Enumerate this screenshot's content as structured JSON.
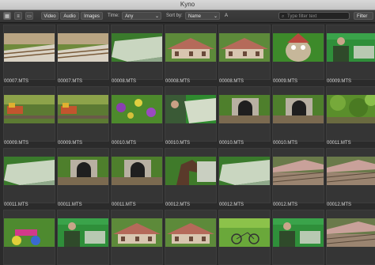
{
  "window": {
    "title": "Kyno"
  },
  "toolbar": {
    "view_icons": [
      "grid-view-icon",
      "list-view-icon",
      "single-view-icon"
    ],
    "filters": [
      "Video",
      "Audio",
      "Images"
    ],
    "time_label": "Time:",
    "time_value": "Any",
    "sort_label": "Sort by:",
    "sort_value": "Name",
    "sort_dir": "A",
    "search_placeholder": "Type filter text",
    "filter_button": "Filter"
  },
  "clips": [
    {
      "name": "00007.MTS",
      "scene": "rail"
    },
    {
      "name": "00007.MTS",
      "scene": "rail"
    },
    {
      "name": "00008.MTS",
      "scene": "board"
    },
    {
      "name": "00008.MTS",
      "scene": "roof"
    },
    {
      "name": "00008.MTS",
      "scene": "roof"
    },
    {
      "name": "00009.MTS",
      "scene": "gnome"
    },
    {
      "name": "00009.MTS",
      "scene": "person"
    },
    {
      "name": "00009.MTS",
      "scene": "train"
    },
    {
      "name": "00009.MTS",
      "scene": "train"
    },
    {
      "name": "00010.MTS",
      "scene": "flowers"
    },
    {
      "name": "00010.MTS",
      "scene": "hand"
    },
    {
      "name": "00010.MTS",
      "scene": "tunnel"
    },
    {
      "name": "00010.MTS",
      "scene": "tunnel"
    },
    {
      "name": "00011.MTS",
      "scene": "foliage"
    },
    {
      "name": "00011.MTS",
      "scene": "board"
    },
    {
      "name": "00011.MTS",
      "scene": "tunnel"
    },
    {
      "name": "00011.MTS",
      "scene": "tunnel"
    },
    {
      "name": "00012.MTS",
      "scene": "horse"
    },
    {
      "name": "00012.MTS",
      "scene": "board"
    },
    {
      "name": "00012.MTS",
      "scene": "station"
    },
    {
      "name": "00012.MTS",
      "scene": "station"
    },
    {
      "name": "",
      "scene": "toy"
    },
    {
      "name": "",
      "scene": "person"
    },
    {
      "name": "",
      "scene": "roof"
    },
    {
      "name": "",
      "scene": "roof"
    },
    {
      "name": "",
      "scene": "bike"
    },
    {
      "name": "",
      "scene": "person"
    },
    {
      "name": "",
      "scene": "station"
    }
  ]
}
